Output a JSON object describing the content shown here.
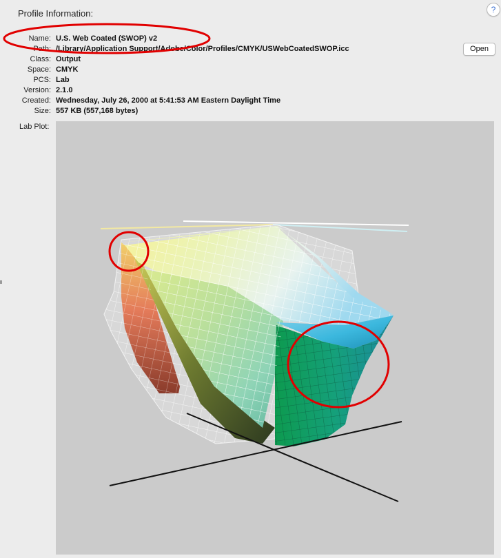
{
  "header": {
    "title": "Profile Information:",
    "help_label": "?"
  },
  "profile": {
    "rows": [
      {
        "label": "Name:",
        "value": "U.S. Web Coated (SWOP) v2"
      },
      {
        "label": "Path:",
        "value": "/Library/Application Support/Adobe/Color/Profiles/CMYK/USWebCoatedSWOP.icc"
      },
      {
        "label": "Class:",
        "value": "Output"
      },
      {
        "label": "Space:",
        "value": "CMYK"
      },
      {
        "label": "PCS:",
        "value": "Lab"
      },
      {
        "label": "Version:",
        "value": "2.1.0"
      },
      {
        "label": "Created:",
        "value": "Wednesday, July 26, 2000 at 5:41:53 AM Eastern Daylight Time"
      },
      {
        "label": "Size:",
        "value": "557 KB (557,168 bytes)"
      }
    ],
    "open_label": "Open"
  },
  "lab_plot": {
    "label": "Lab Plot:",
    "toggle_symbol": "▼"
  },
  "colors": {
    "panel_background": "#ececec",
    "plot_background": "#cbcbcb",
    "annotation_red": "#e10000",
    "help_blue": "#3a6fd0"
  },
  "icons": {
    "help": "question-mark-icon",
    "disclosure": "disclosure-triangle-icon"
  }
}
